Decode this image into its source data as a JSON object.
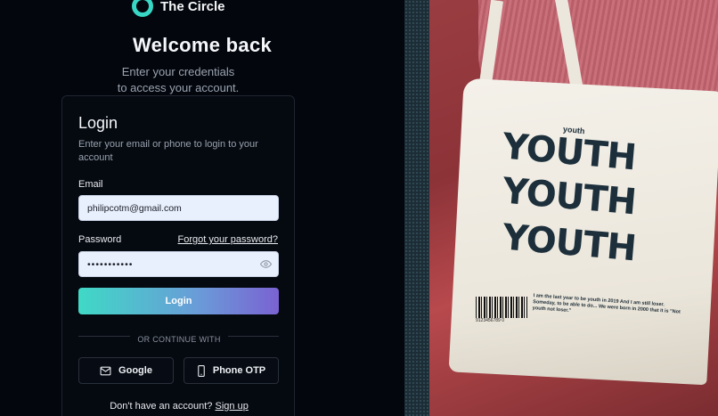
{
  "brand": {
    "name": "The Circle",
    "logo_color": "#38d6c4"
  },
  "hero": {
    "title": "Welcome back",
    "subtitle_line1": "Enter your credentials",
    "subtitle_line2": "to access your account."
  },
  "card": {
    "title": "Login",
    "description": "Enter your email or phone to login to your account",
    "email_label": "Email",
    "email_value": "philipcotm@gmail.com",
    "password_label": "Password",
    "forgot_label": "Forgot your password?",
    "password_value": "•••••••••••",
    "login_button": "Login",
    "divider_text": "OR CONTINUE WITH",
    "google_label": "Google",
    "phone_label": "Phone OTP",
    "signup_prompt": "Don't have an account?",
    "signup_link": "Sign up"
  },
  "photo": {
    "bag_small_text": "youth",
    "bag_lines": [
      "YOUTH",
      "YOUTH",
      "YOUTH"
    ],
    "barcode_number": "9123456789 0",
    "bag_caption": "I am the last year to be youth in 2019 And I am still loser. Someday, to be able to do... We were born in 2000 that it is \"Not youth not loser.\""
  },
  "colors": {
    "accent_start": "#3fd9c6",
    "accent_end": "#7a62d2",
    "background": "#03060d"
  }
}
